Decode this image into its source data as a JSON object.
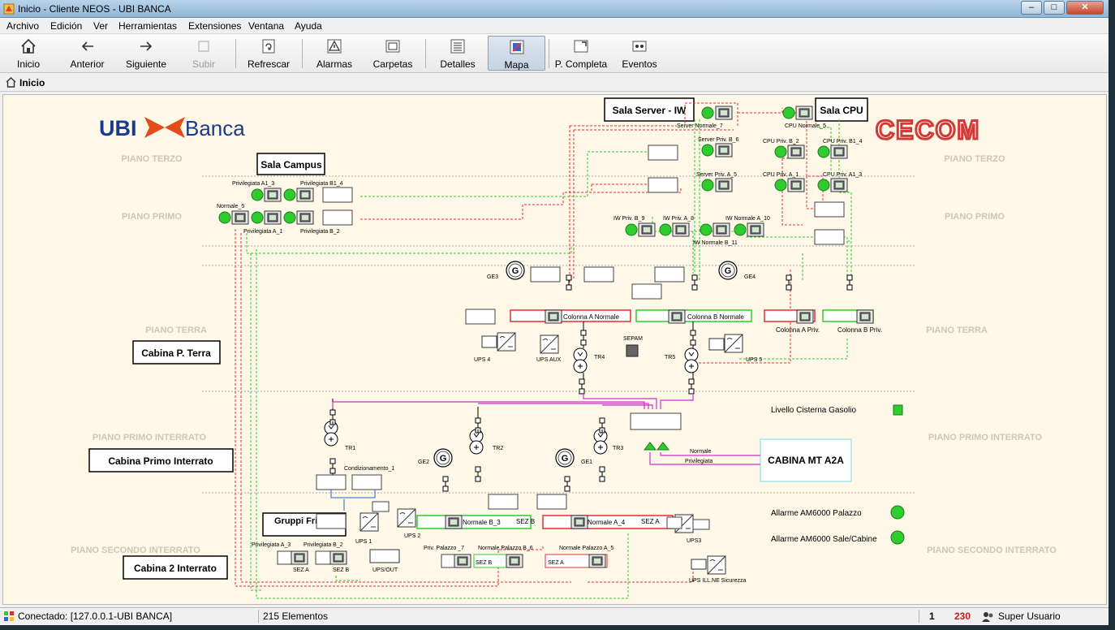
{
  "window": {
    "title": "Inicio - Cliente NEOS - UBI BANCA"
  },
  "menu": [
    "Archivo",
    "Edición",
    "Ver",
    "Herramientas",
    "Extensiones",
    "Ventana",
    "Ayuda"
  ],
  "toolbar": {
    "home": "Inicio",
    "back": "Anterior",
    "forward": "Siguiente",
    "up": "Subir",
    "refresh": "Refrescar",
    "alarms": "Alarmas",
    "folders": "Carpetas",
    "details": "Detalles",
    "map": "Mapa",
    "fullpage": "P. Completa",
    "events": "Eventos"
  },
  "breadcrumb": "Inicio",
  "map": {
    "logo_left": "UBI Banca",
    "logo_right": "CECOM",
    "floors": {
      "piano_terzo": "PIANO TERZO",
      "piano_primo": "PIANO PRIMO",
      "piano_terra": "PIANO TERRA",
      "piano_primo_interrato": "PIANO PRIMO INTERRATO",
      "piano_secondo_interrato": "PIANO SECONDO INTERRATO"
    },
    "rooms": {
      "sala_server": "Sala Server - IW",
      "sala_cpu": "Sala CPU",
      "sala_campus": "Sala Campus",
      "cabina_p_terra": "Cabina P. Terra",
      "cabina_primo": "Cabina Primo Interrato",
      "cabina_2": "Cabina 2 Interrato",
      "gruppi_frigo": "Gruppi Frigo",
      "cabina_mt": "CABINA MT A2A"
    },
    "labels": {
      "server_normale_7": "Server Normale_7",
      "cpu_normale_5": "CPU Normale_5",
      "server_priv_b6": "Server Priv. B_6",
      "server_priv_a5": "Server Priv. A_5",
      "cpu_priv_b2": "CPU Priv. B_2",
      "cpu_priv_b14": "CPU Priv. B1_4",
      "cpu_priv_a1": "CPU Priv. A_1",
      "cpu_priv_a13": "CPU Priv. A1_3",
      "iw_priv_b9": "IW Priv. B_9",
      "iw_priv_a8": "IW Priv. A_8",
      "iw_normale_a10": "IW Normale A_10",
      "iw_normale_b11": "IW Normale B_11",
      "privilegiata_a13": "Privilegiata A1_3",
      "privilegiata_b14": "Privilegiata B1_4",
      "normale_5": "Normale_5",
      "privilegiata_a1": "Privilegiata A_1",
      "privilegiata_b2": "Privilegiata B_2",
      "ge3": "GE3",
      "ge4": "GE4",
      "ge2": "GE2",
      "ge1": "GE1",
      "colonna_a_normale": "Colonna A Normale",
      "colonna_b_normale": "Colonna B Normale",
      "colonna_a_priv": "Colonna A Priv.",
      "colonna_b_priv": "Colonna B Priv.",
      "ups4": "UPS 4",
      "ups_aux": "UPS AUX",
      "tr4": "TR4",
      "sepam": "SEPAM",
      "tr5": "TR5",
      "ups5": "UPS 5",
      "tr1": "TR1",
      "tr2": "TR2",
      "tr3": "TR3",
      "condizionamento": "Condizionamento_1",
      "livello": "Livello Cisterna Gasolio",
      "normale": "Normale",
      "privilegiata": "Privilegiata",
      "normale_b3": "Normale B_3",
      "sez_b": "SEZ B",
      "normale_a4": "Normale A_4",
      "sez_a": "SEZ A",
      "ups1": "UPS 1",
      "ups2": "UPS 2",
      "ups3": "UPS3",
      "priv_palazzo_7": "Priv. Palazzo _7",
      "normale_palazzo_b6": "Normale Palazzo B_6",
      "normale_palazzo_a5": "Normale Palazzo A_5",
      "ups_out": "UPS/OUT",
      "privilegiata_a_3": "Privilegiata A_3",
      "privilegiata_b_2b": "Privilegiata B_2",
      "ups_illne": "UPS ILL.NE Sicurezza",
      "allarme_palazzo": "Allarme AM6000 Palazzo",
      "allarme_sale": "Allarme AM6000 Sale/Cabine"
    }
  },
  "status": {
    "connection": "Conectado: [127.0.0.1-UBI BANCA]",
    "elements": "215 Elementos",
    "count1": "1",
    "count2": "230",
    "user": "Super Usuario"
  },
  "colors": {
    "red": "#e03030",
    "green": "#2ecc2e",
    "magenta": "#cc33cc",
    "blue": "#2266cc",
    "floor_text": "#cfc6b4"
  }
}
